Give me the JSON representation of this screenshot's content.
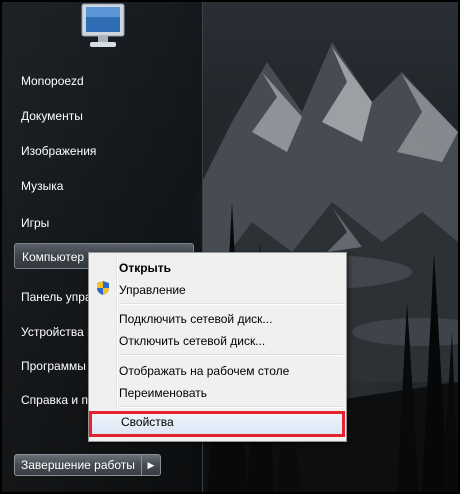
{
  "start_menu": {
    "items": [
      {
        "label": "Monopoezd"
      },
      {
        "label": "Документы"
      },
      {
        "label": "Изображения"
      },
      {
        "label": "Музыка"
      },
      {
        "label": "Игры"
      },
      {
        "label": "Компьютер"
      },
      {
        "label": "Панель упра"
      },
      {
        "label": "Устройства п"
      },
      {
        "label": "Программы"
      },
      {
        "label": "Справка и п"
      }
    ],
    "shutdown_label": "Завершение работы",
    "user_icon": "monitor-icon"
  },
  "context_menu": {
    "items": [
      {
        "label": "Открыть",
        "bold": true
      },
      {
        "label": "Управление",
        "icon": "shield-icon"
      },
      {
        "label": "Подключить сетевой диск..."
      },
      {
        "label": "Отключить сетевой диск..."
      },
      {
        "label": "Отображать на рабочем столе"
      },
      {
        "label": "Переименовать"
      },
      {
        "label": "Свойства"
      }
    ]
  },
  "colors": {
    "highlight_border": "#e8212e"
  }
}
